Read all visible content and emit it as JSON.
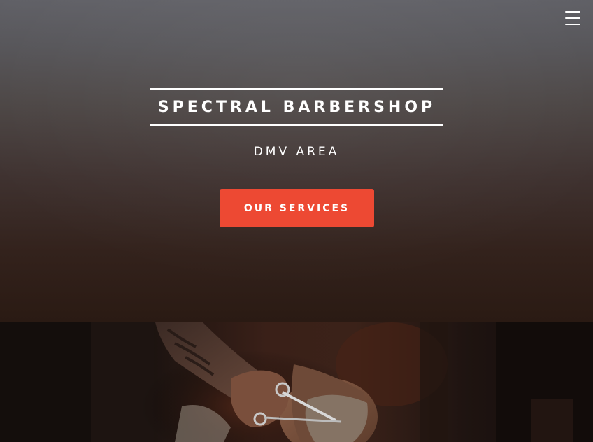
{
  "hero": {
    "title": "SPECTRAL BARBERSHOP",
    "subtitle": "DMV AREA",
    "cta_label": "OUR SERVICES",
    "accent_color": "#ed4933"
  },
  "nav": {
    "menu_icon": "hamburger-menu-icon"
  },
  "photo": {
    "subject": "barber-trimming-beard-image"
  }
}
